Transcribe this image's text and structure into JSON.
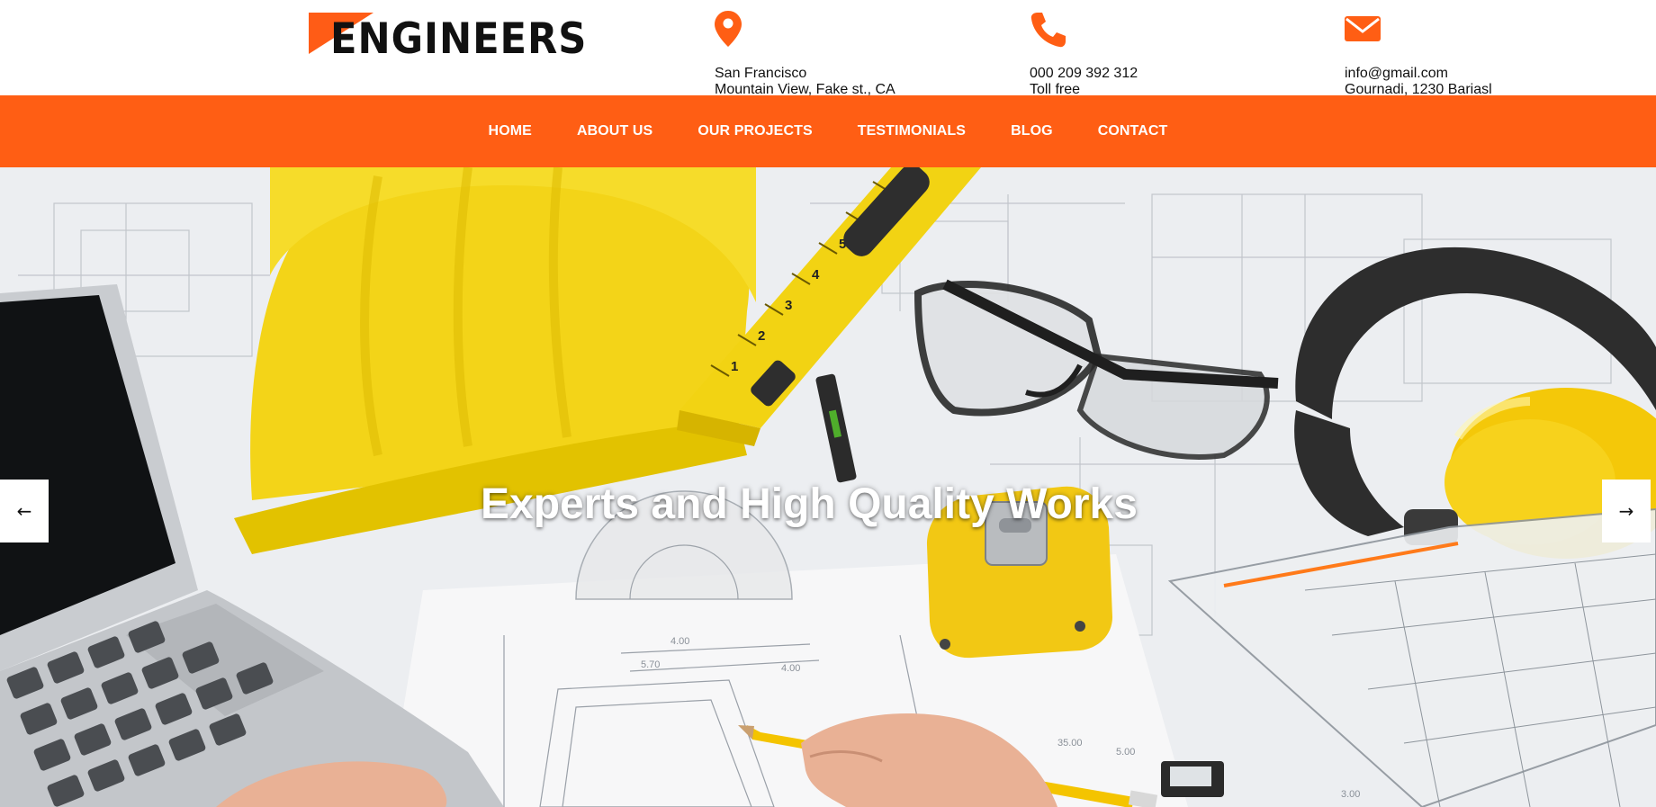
{
  "brand": {
    "logo_text": "ENGINEERS",
    "accent_color": "#ff5e14"
  },
  "contact": {
    "location": {
      "icon": "map-pin-icon",
      "line1": "San Francisco",
      "line2": "Mountain View, Fake st., CA"
    },
    "phone": {
      "icon": "phone-icon",
      "line1": "000 209 392 312",
      "line2": "Toll free"
    },
    "email": {
      "icon": "envelope-icon",
      "line1": "info@gmail.com",
      "line2": "Gournadi, 1230 Bariasl"
    }
  },
  "nav": {
    "items": [
      {
        "label": "HOME"
      },
      {
        "label": "ABOUT US"
      },
      {
        "label": "OUR PROJECTS"
      },
      {
        "label": "TESTIMONIALS"
      },
      {
        "label": "BLOG"
      },
      {
        "label": "CONTACT"
      }
    ]
  },
  "hero": {
    "title": "Experts and High Quality Works",
    "prev_icon": "arrow-left-icon",
    "next_icon": "arrow-right-icon"
  }
}
